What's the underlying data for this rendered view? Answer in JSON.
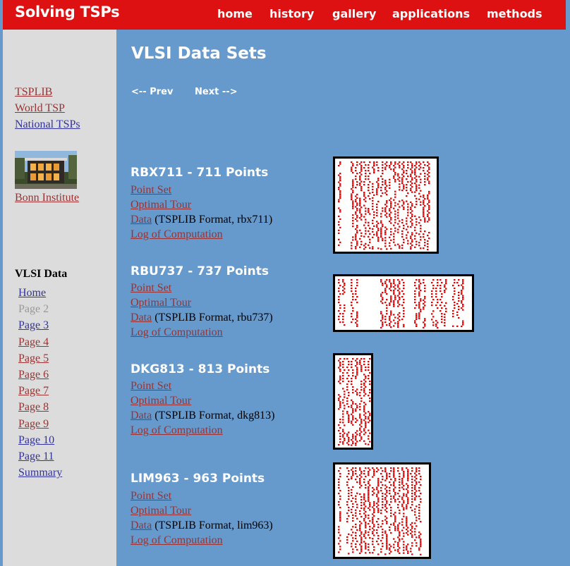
{
  "header": {
    "title": "Solving TSPs",
    "nav": [
      "home",
      "history",
      "gallery",
      "applications",
      "methods"
    ]
  },
  "sidebar": {
    "top_links": [
      "TSPLIB",
      "World TSP",
      "National TSPs"
    ],
    "institute_link": "Bonn Institute",
    "section_heading": "VLSI Data",
    "pages": [
      "Home",
      "Page 2",
      "Page 3",
      "Page 4",
      "Page 5",
      "Page 6",
      "Page 7",
      "Page 8",
      "Page 9",
      "Page 10",
      "Page 11",
      "Summary"
    ],
    "current_page": "Page 2"
  },
  "main": {
    "heading": "VLSI Data Sets",
    "prev_label": "<-- Prev",
    "next_label": "Next -->",
    "datasets": [
      {
        "title": "RBX711 - 711 Points",
        "point_set": "Point Set",
        "optimal_tour": "Optimal Tour",
        "data": "Data",
        "data_desc": " (TSPLIB Format, rbx711)",
        "log": "Log of Computation"
      },
      {
        "title": "RBU737 - 737 Points",
        "point_set": "Point Set",
        "optimal_tour": "Optimal Tour",
        "data": "Data",
        "data_desc": " (TSPLIB Format, rbu737)",
        "log": "Log of Computation"
      },
      {
        "title": "DKG813 - 813 Points",
        "point_set": "Point Set",
        "optimal_tour": "Optimal Tour",
        "data": "Data",
        "data_desc": " (TSPLIB Format, dkg813)",
        "log": "Log of Computation"
      },
      {
        "title": "LIM963 - 963 Points",
        "point_set": "Point Set",
        "optimal_tour": "Optimal Tour",
        "data": "Data",
        "data_desc": " (TSPLIB Format, lim963)",
        "log": "Log of Computation"
      }
    ]
  },
  "colors": {
    "header_red": "#dd1111",
    "main_blue": "#6699cc",
    "sidebar_gray": "#dcdcdc",
    "link_red": "#993333",
    "link_blue": "#333399",
    "point_red": "#ee0000"
  }
}
